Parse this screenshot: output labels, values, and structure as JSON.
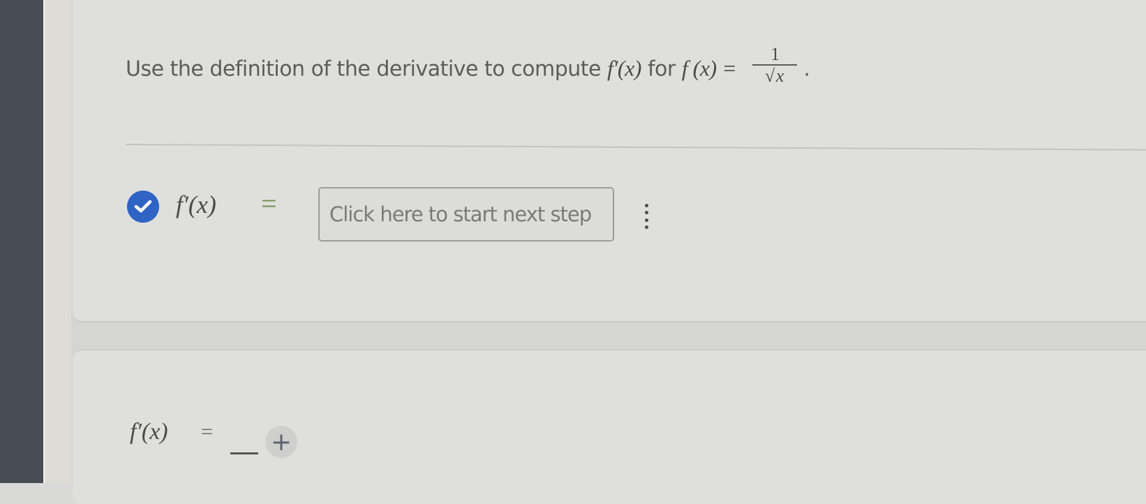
{
  "question": {
    "prefix": "Use the definition of the derivative to compute",
    "derivative_expr": "f′(x)",
    "connector": "for",
    "function_expr": "f (x) =",
    "fraction_numerator": "1",
    "fraction_radical": "√",
    "fraction_radicand": "x",
    "suffix": "."
  },
  "step": {
    "status": "completed",
    "lhs": "f′(x)",
    "equals": "=",
    "input_placeholder": "Click here to start next step",
    "menu_icon": "kebab-menu-icon",
    "check_color": "#2f63c4"
  },
  "answer": {
    "lhs": "f′(x)",
    "equals": "=",
    "blank": "",
    "add_label": "+"
  }
}
